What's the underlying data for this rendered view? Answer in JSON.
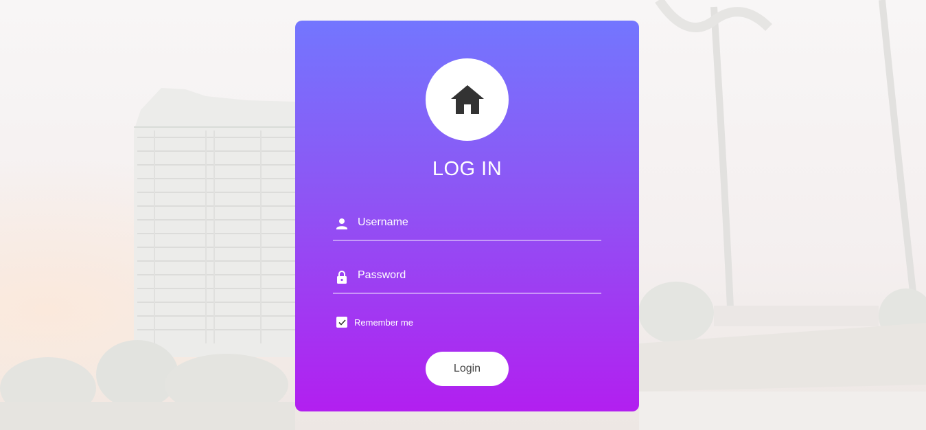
{
  "page": {
    "title": "LOG IN"
  },
  "form": {
    "username": {
      "value": "",
      "placeholder": "Username",
      "icon": "person-icon"
    },
    "password": {
      "value": "",
      "placeholder": "Password",
      "icon": "lock-icon"
    },
    "remember": {
      "label": "Remember me",
      "checked": true
    },
    "login_label": "Login"
  },
  "icons": {
    "avatar": "home-icon"
  },
  "colors": {
    "gradient_top": "#7376fe",
    "gradient_bottom": "#b21ff0",
    "text": "#ffffff",
    "button_text": "#444444"
  }
}
